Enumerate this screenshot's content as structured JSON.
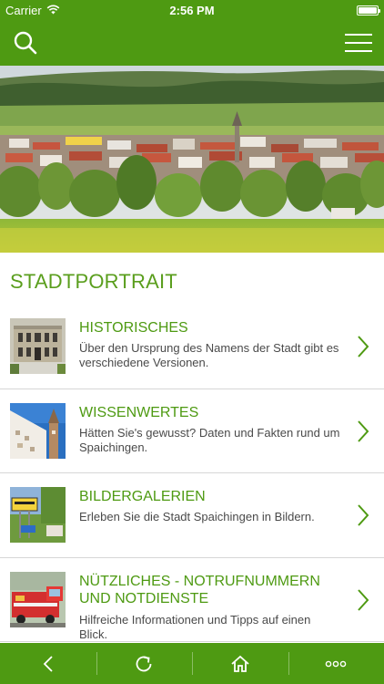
{
  "status_bar": {
    "carrier": "Carrier",
    "time": "2:56 PM",
    "battery_level": 1.0
  },
  "header": {
    "left_icon": "search-icon",
    "right_icon": "hamburger-menu-icon",
    "color": "#4e9a12"
  },
  "hero": {
    "description_icon": "town-panorama-image"
  },
  "section": {
    "title": "STADTPORTRAIT"
  },
  "items": [
    {
      "title": "HISTORISCHES",
      "description": "Über den Ursprung des Namens der Stadt gibt es verschiedene Versionen."
    },
    {
      "title": "WISSENWERTES",
      "description": "Hätten Sie's gewusst? Daten und Fakten rund um Spaichingen."
    },
    {
      "title": "BILDERGALERIEN",
      "description": "Erleben Sie die Stadt Spaichingen in Bildern."
    },
    {
      "title": "NÜTZLICHES - NOTRUFNUMMERN UND NOTDIENSTE",
      "description": "Hilfreiche Informationen und Tipps auf einen Blick."
    }
  ],
  "bottom_bar": {
    "tabs": [
      "back-icon",
      "refresh-icon",
      "home-icon",
      "more-icon"
    ]
  },
  "colors": {
    "brand_green": "#4e9a12",
    "title_green": "#5a9e1d",
    "text_gray": "#4a4a4a",
    "divider": "#d6d6d6"
  }
}
